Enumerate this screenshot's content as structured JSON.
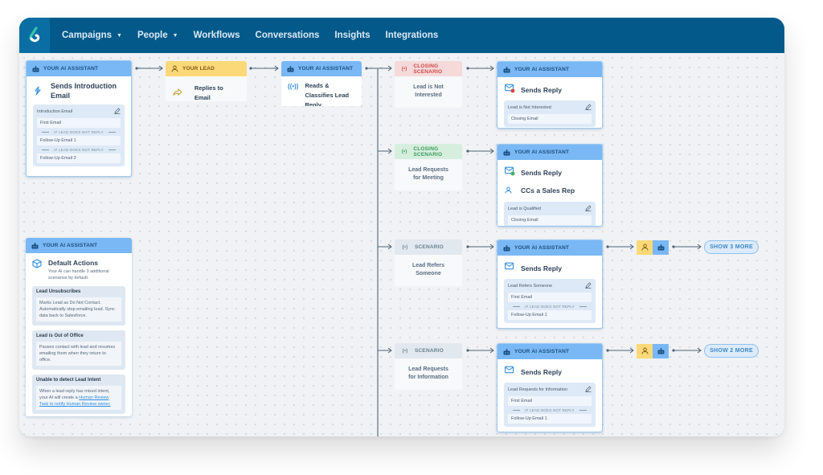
{
  "nav": {
    "logo": "brand-logo",
    "items": [
      {
        "label": "Campaigns",
        "dropdown": true
      },
      {
        "label": "People",
        "dropdown": true
      },
      {
        "label": "Workflows",
        "dropdown": false
      },
      {
        "label": "Conversations",
        "dropdown": false
      },
      {
        "label": "Insights",
        "dropdown": false
      },
      {
        "label": "Integrations",
        "dropdown": false
      }
    ]
  },
  "labels": {
    "ai": "YOUR AI ASSISTANT",
    "lead": "YOUR LEAD",
    "closing": "CLOSING SCENARIO",
    "scenario": "SCENARIO",
    "if_no_reply": "IF LEAD DOES NOT REPLY"
  },
  "intro": {
    "title": "Sends Introduction Email",
    "panel": "Introduction Email",
    "emails": [
      "First Email",
      "Follow-Up Email 1",
      "Follow-Up Email 2"
    ]
  },
  "lead_node": {
    "title": "Replies to Email"
  },
  "classify": {
    "title": "Reads & Classifies Lead Reply"
  },
  "default_actions": {
    "title": "Default Actions",
    "subtitle": "Your AI can handle 3 additional scenarios by default.",
    "actions": [
      {
        "title": "Lead Unsubscribes",
        "desc": "Marks Lead as Do Not Contact. Automatically stop emailing lead. Sync data back to Salesforce."
      },
      {
        "title": "Lead is Out of Office",
        "desc": "Pauses contact with lead and resumes emailing them when they return to office."
      },
      {
        "title": "Unable to detect Lead Intent",
        "desc": "When a lead reply has mixed intent, your AI will create a ",
        "link": "Human Review Task to notify Human Review owner."
      }
    ]
  },
  "scenarios": [
    {
      "type": "closing-red",
      "body": [
        "Lead is Not",
        "Interested"
      ],
      "reply": {
        "title": "Sends Reply",
        "extra": null,
        "panel": "Lead is Not Interested",
        "emails": [
          "Closing Email"
        ]
      }
    },
    {
      "type": "closing-green",
      "body": [
        "Lead Requests",
        "for Meeting"
      ],
      "reply": {
        "title": "Sends Reply",
        "extra": "CCs a Sales Rep",
        "panel": "Lead is Qualified",
        "emails": [
          "Closing Email"
        ]
      }
    },
    {
      "type": "scenario",
      "body": [
        "Lead Refers",
        "Someone"
      ],
      "reply": {
        "title": "Sends Reply",
        "extra": null,
        "panel": "Lead Refers Someone",
        "emails": [
          "First Email",
          "Follow-Up Email 1"
        ]
      },
      "show_more": "SHOW 3 MORE"
    },
    {
      "type": "scenario",
      "body": [
        "Lead Requests",
        "for Information"
      ],
      "reply": {
        "title": "Sends Reply",
        "extra": null,
        "panel": "Lead Requests for Information",
        "emails": [
          "First Email",
          "Follow-Up Email 1"
        ]
      },
      "show_more": "SHOW 2 MORE"
    }
  ],
  "colors": {
    "nav": "#035a8a",
    "ai_header": "#79b8f5",
    "lead_header": "#fcd978",
    "closing_red": "#f6d9d9",
    "closing_green": "#d6eede",
    "scenario": "#e2e8ef"
  }
}
